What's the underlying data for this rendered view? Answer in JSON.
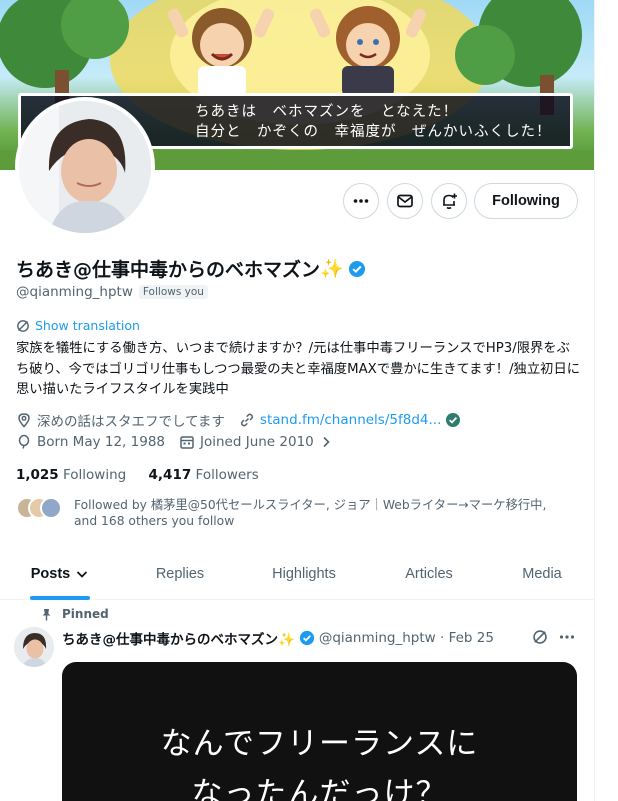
{
  "banner": {
    "line1": "ちあきは　ベホマズンを　となえた！",
    "line2": "自分と　かぞくの　幸福度が　ぜんかいふくした！"
  },
  "actions": {
    "more_icon": "more-icon",
    "message_icon": "mail-icon",
    "notify_icon": "bell-plus-icon",
    "following_label": "Following"
  },
  "profile": {
    "display_name": "ちあき@仕事中毒からのベホマズン",
    "name_emoji": "✨",
    "handle": "@qianming_hptw",
    "follows_you": "Follows you",
    "show_translation": "Show translation",
    "bio": "家族を犠牲にする働き方、いつまで続けますか？/元は仕事中毒フリーランスでHP3/限界をぶち破り、今ではゴリゴリ仕事もしつつ最愛の夫と幸福度MAXで豊かに生きてます！/独立初日に思い描いたライフスタイルを実践中",
    "location": "深めの話はスタエフでしてます",
    "link": "stand.fm/channels/5f8d4...",
    "birthday": "Born May 12, 1988",
    "joined": "Joined June 2010",
    "following_count": "1,025",
    "following_label": "Following",
    "followers_count": "4,417",
    "followers_label": "Followers",
    "followed_by_line1": "Followed by 橘茅里@50代セールスライター, ジョア｜Webライター→マーケ移行中,",
    "followed_by_line2": "and 168 others you follow"
  },
  "tabs": [
    {
      "label": "Posts",
      "active": true
    },
    {
      "label": "Replies",
      "active": false
    },
    {
      "label": "Highlights",
      "active": false
    },
    {
      "label": "Articles",
      "active": false
    },
    {
      "label": "Media",
      "active": false
    }
  ],
  "pinned_post": {
    "pinned_label": "Pinned",
    "author": "ちあき@仕事中毒からのベホマズン✨",
    "handle_date": "@qianming_hptw · Feb 25",
    "media_line1": "なんでフリーランスに",
    "media_line2": "なったんだっけ？"
  },
  "colors": {
    "accent": "#1d9bf0",
    "verified": "#1d9bf0",
    "text": "#0f1419",
    "muted": "#536471"
  }
}
